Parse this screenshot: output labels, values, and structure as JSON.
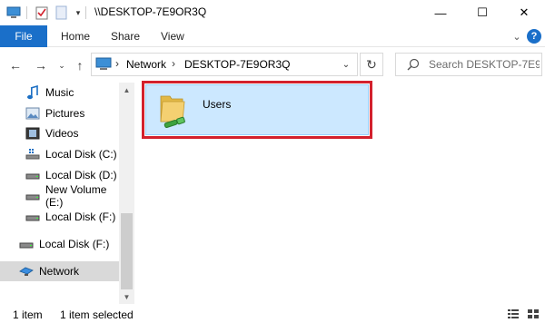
{
  "window": {
    "title": "\\\\DESKTOP-7E9OR3Q",
    "minimize": "—",
    "maximize": "☐",
    "close": "✕"
  },
  "ribbon": {
    "file": "File",
    "tabs": [
      "Home",
      "Share",
      "View"
    ],
    "help": "?"
  },
  "address": {
    "crumbs": [
      "Network",
      "DESKTOP-7E9OR3Q"
    ],
    "separator": "›"
  },
  "search": {
    "placeholder": "Search DESKTOP-7E9..."
  },
  "nav": {
    "items": [
      {
        "label": "Music",
        "icon": "music-icon"
      },
      {
        "label": "Pictures",
        "icon": "pictures-icon"
      },
      {
        "label": "Videos",
        "icon": "videos-icon"
      },
      {
        "label": "Local Disk (C:)",
        "icon": "drive-c-icon"
      },
      {
        "label": "Local Disk (D:)",
        "icon": "drive-icon"
      },
      {
        "label": "New Volume (E:)",
        "icon": "drive-icon"
      },
      {
        "label": "Local Disk (F:)",
        "icon": "drive-icon"
      },
      {
        "label": "Local Disk (F:)",
        "icon": "drive-icon"
      },
      {
        "label": "Network",
        "icon": "network-icon"
      }
    ]
  },
  "content": {
    "items": [
      {
        "name": "Users",
        "icon": "shared-folder-icon"
      }
    ],
    "highlight_color": "#d3212d"
  },
  "status": {
    "count": "1 item",
    "selected": "1 item selected"
  },
  "colors": {
    "accent": "#1a6fc9",
    "selection": "#cce8ff"
  }
}
